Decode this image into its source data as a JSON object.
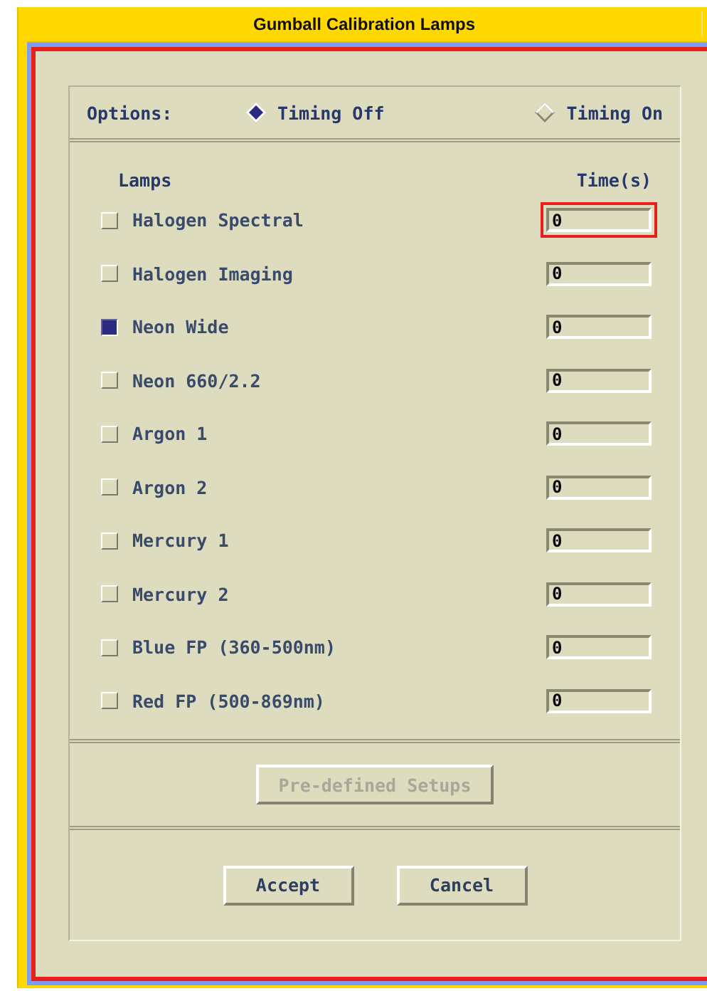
{
  "window": {
    "title": "Gumball Calibration Lamps"
  },
  "options": {
    "label": "Options:",
    "choices": [
      {
        "label": "Timing Off",
        "selected": true
      },
      {
        "label": "Timing On",
        "selected": false
      }
    ]
  },
  "lamps": {
    "header_name": "Lamps",
    "header_time": "Time(s)",
    "rows": [
      {
        "name": "Halogen Spectral",
        "checked": false,
        "time": "0",
        "focused": true
      },
      {
        "name": "Halogen Imaging",
        "checked": false,
        "time": "0",
        "focused": false
      },
      {
        "name": "Neon Wide",
        "checked": true,
        "time": "0",
        "focused": false
      },
      {
        "name": "Neon 660/2.2",
        "checked": false,
        "time": "0",
        "focused": false
      },
      {
        "name": "Argon 1",
        "checked": false,
        "time": "0",
        "focused": false
      },
      {
        "name": "Argon 2",
        "checked": false,
        "time": "0",
        "focused": false
      },
      {
        "name": "Mercury 1",
        "checked": false,
        "time": "0",
        "focused": false
      },
      {
        "name": "Mercury 2",
        "checked": false,
        "time": "0",
        "focused": false
      },
      {
        "name": "Blue FP (360-500nm)",
        "checked": false,
        "time": "0",
        "focused": false
      },
      {
        "name": "Red FP (500-869nm)",
        "checked": false,
        "time": "0",
        "focused": false
      }
    ]
  },
  "setups_button": {
    "label": "Pre-defined Setups",
    "disabled": true
  },
  "buttons": [
    "Accept",
    "Cancel"
  ]
}
